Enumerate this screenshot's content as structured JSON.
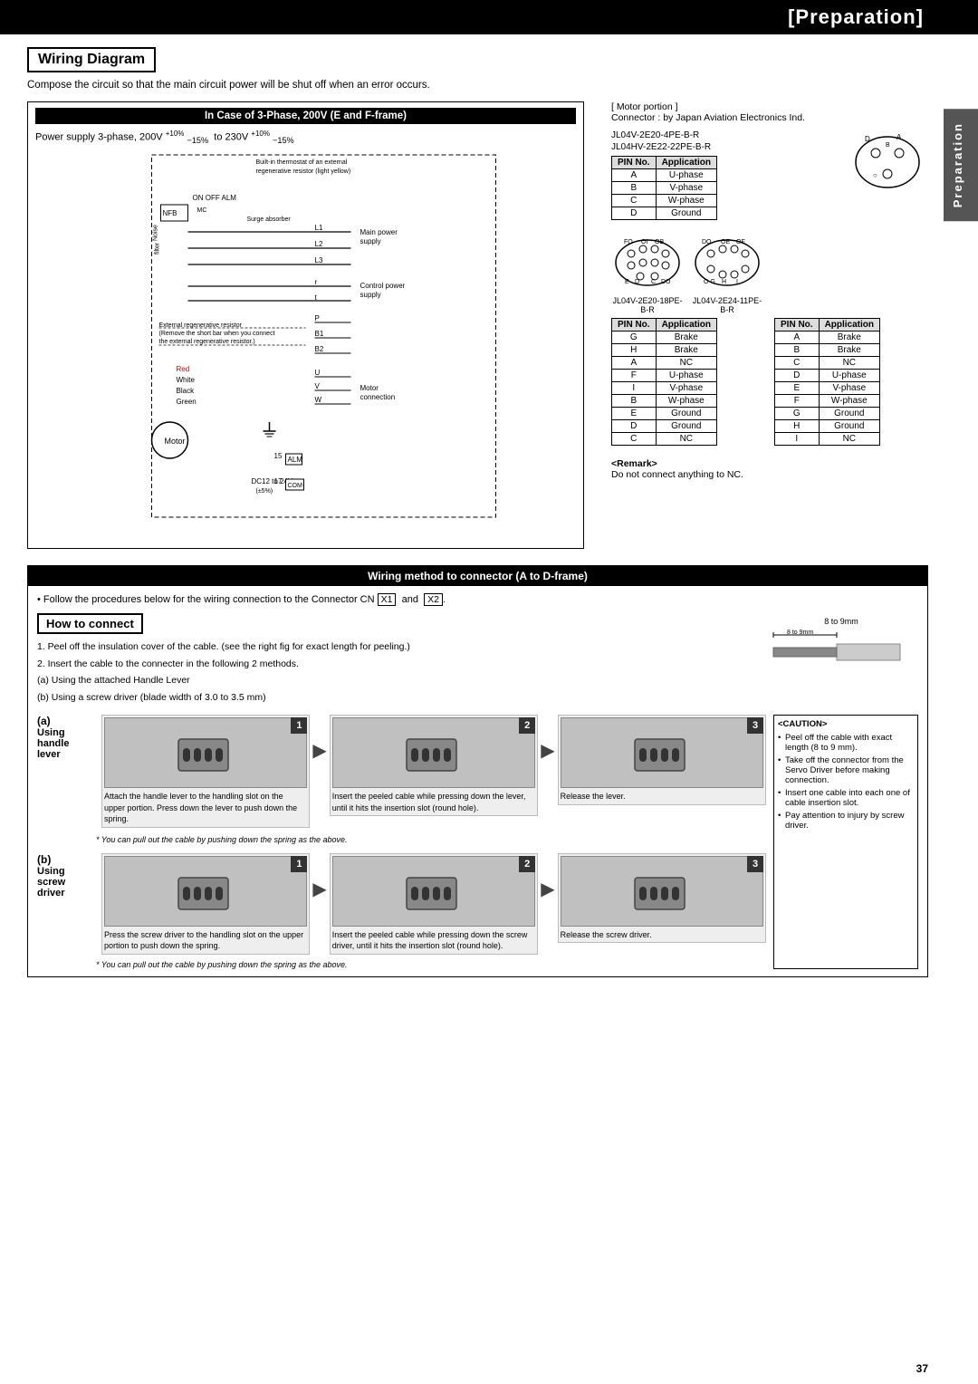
{
  "header": {
    "title": "[Preparation]"
  },
  "side_tab": {
    "label": "Preparation"
  },
  "wiring_diagram": {
    "section_title": "Wiring Diagram",
    "intro": "Compose the circuit so that the main circuit power will be shut off when an error occurs."
  },
  "phase_section": {
    "title": "In Case of 3-Phase, 200V (E and F-frame)",
    "power_supply": "Power supply  3-phase, 200V",
    "plus10": "+10%",
    "minus15": "−15%",
    "to": "to  230V",
    "plus10b": "+10%",
    "minus15b": "−15%"
  },
  "motor_portion": {
    "label": "[ Motor portion ]",
    "connector": "Connector : by Japan Aviation Electronics Ind.",
    "parts": [
      "JL04V-2E20-4PE-B-R",
      "JL04HV-2E22-22PE-B-R"
    ],
    "main_table": {
      "headers": [
        "PIN No.",
        "Application"
      ],
      "rows": [
        [
          "A",
          "U-phase"
        ],
        [
          "B",
          "V-phase"
        ],
        [
          "C",
          "W-phase"
        ],
        [
          "D",
          "Ground"
        ]
      ]
    },
    "table2_label": "JL04V-2E20-18PE-B-R",
    "table2": {
      "headers": [
        "PIN No.",
        "Application"
      ],
      "rows": [
        [
          "G",
          "Brake"
        ],
        [
          "H",
          "Brake"
        ],
        [
          "A",
          "NC"
        ],
        [
          "F",
          "U-phase"
        ],
        [
          "I",
          "V-phase"
        ],
        [
          "B",
          "W-phase"
        ],
        [
          "E",
          "Ground"
        ],
        [
          "D",
          "Ground"
        ],
        [
          "C",
          "NC"
        ]
      ]
    },
    "table3_label": "JL04V-2E24-11PE-B-R",
    "table3": {
      "headers": [
        "PIN No.",
        "Application"
      ],
      "rows": [
        [
          "A",
          "Brake"
        ],
        [
          "B",
          "Brake"
        ],
        [
          "C",
          "NC"
        ],
        [
          "D",
          "U-phase"
        ],
        [
          "E",
          "V-phase"
        ],
        [
          "F",
          "W-phase"
        ],
        [
          "G",
          "Ground"
        ],
        [
          "H",
          "Ground"
        ],
        [
          "I",
          "NC"
        ]
      ]
    },
    "remark_title": "<Remark>",
    "remark_text": "Do not connect anything to NC."
  },
  "wiring_method": {
    "title": "Wiring method to connector (A to D-frame)",
    "follow_text": "• Follow the procedures below for the wiring connection to the Connector CN",
    "cn1": "X1",
    "and": "and",
    "cn2": "X2",
    "how_to_connect": "How to connect",
    "instructions": [
      "1. Peel off the insulation cover of the cable.  (see the right fig for exact length for peeling.)",
      "2. Insert the cable to the connecter in the following 2 methods.",
      "   (a) Using the attached Handle Lever",
      "   (b) Using a screw driver (blade width of 3.0 to 3.5 mm)"
    ],
    "cable_dim": "8 to 9mm"
  },
  "method_a": {
    "label_a": "(a)",
    "label_using": "Using",
    "label_handle": "handle",
    "label_lever": "lever",
    "steps": [
      {
        "num": "1",
        "caption": "Attach the handle lever to the handling slot on the upper portion. Press down the lever to push down the spring."
      },
      {
        "num": "2",
        "caption": "Insert the peeled cable while pressing down the lever, until it hits the insertion slot (round hole)."
      },
      {
        "num": "3",
        "caption": "Release the lever."
      }
    ],
    "pull_note": "* You can pull out the cable by pushing down the spring as the above."
  },
  "method_b": {
    "label_b": "(b)",
    "label_using": "Using",
    "label_screw": "screw",
    "label_driver": "driver",
    "steps": [
      {
        "num": "1",
        "caption": "Press the screw driver to the handling slot on the upper portion to push down the spring."
      },
      {
        "num": "2",
        "caption": "Insert the peeled cable while pressing down the screw driver, until it hits the insertion slot (round hole)."
      },
      {
        "num": "3",
        "caption": "Release the screw driver."
      }
    ],
    "pull_note": "* You can pull out the cable by pushing down the spring as the above."
  },
  "caution": {
    "title": "<CAUTION>",
    "items": [
      "Peel off the cable with exact length (8 to 9 mm).",
      "Take off the connector from the Servo Driver before making connection.",
      "Insert one cable into each one of cable insertion slot.",
      "Pay attention to injury by screw driver."
    ]
  },
  "page_number": "37"
}
